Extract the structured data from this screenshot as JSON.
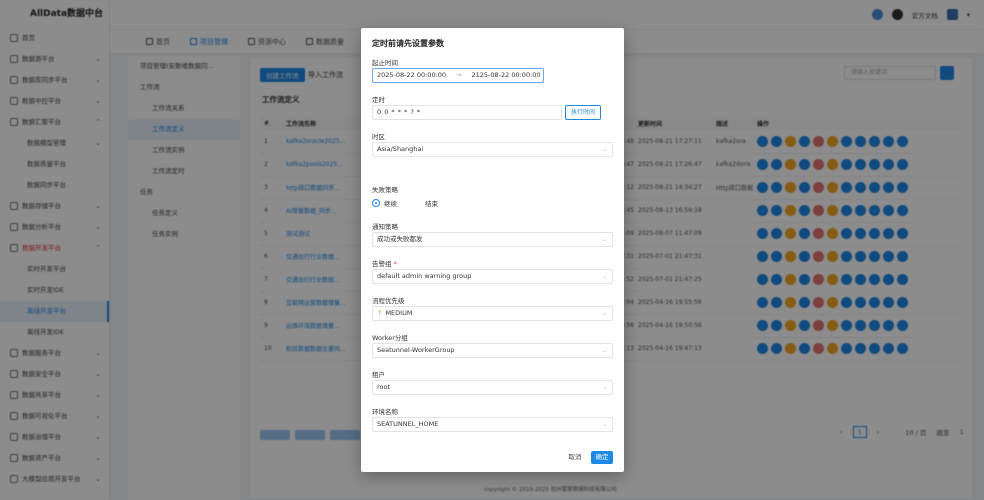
{
  "app": {
    "title": "AllData数据中台"
  },
  "header": {
    "docs_link": "官方文档"
  },
  "sidebar": {
    "items": [
      {
        "label": "首页",
        "type": "top"
      },
      {
        "label": "数据源平台",
        "type": "top",
        "caret": "⌄"
      },
      {
        "label": "数据库同步平台",
        "type": "top",
        "caret": "⌄"
      },
      {
        "label": "数据中控平台",
        "type": "top",
        "caret": "⌄"
      },
      {
        "label": "数据汇聚平台",
        "type": "top",
        "caret": "⌃"
      },
      {
        "label": "数据模型管理",
        "type": "sub",
        "caret": "⌄"
      },
      {
        "label": "数据质量平台",
        "type": "sub"
      },
      {
        "label": "数据同步平台",
        "type": "sub"
      },
      {
        "label": "数据存储平台",
        "type": "top",
        "caret": "⌄"
      },
      {
        "label": "数据分析平台",
        "type": "top",
        "caret": "⌄"
      },
      {
        "label": "数据开发平台",
        "type": "top-open",
        "caret": "⌃"
      },
      {
        "label": "实时开发平台",
        "type": "sub"
      },
      {
        "label": "实时开发IDE",
        "type": "sub"
      },
      {
        "label": "离线开发平台",
        "type": "sub-active"
      },
      {
        "label": "离线开发IDE",
        "type": "sub"
      },
      {
        "label": "数据服务平台",
        "type": "top",
        "caret": "⌄"
      },
      {
        "label": "数据安全平台",
        "type": "top",
        "caret": "⌄"
      },
      {
        "label": "数据共享平台",
        "type": "top",
        "caret": "⌄"
      },
      {
        "label": "数据可视化平台",
        "type": "top",
        "caret": "⌄"
      },
      {
        "label": "数据治理平台",
        "type": "top",
        "caret": "⌄"
      },
      {
        "label": "数据资产平台",
        "type": "top",
        "caret": "⌄"
      },
      {
        "label": "大模型应用开发平台",
        "type": "top",
        "caret": "⌄"
      }
    ]
  },
  "tabs": [
    {
      "label": "首页",
      "active": false
    },
    {
      "label": "项目管理",
      "active": true
    },
    {
      "label": "资源中心",
      "active": false
    },
    {
      "label": "数据质量",
      "active": false
    }
  ],
  "subnav": {
    "items": [
      {
        "label": "项目管理(安斯维数据同...",
        "level": 1
      },
      {
        "label": "工作流",
        "level": 1
      },
      {
        "label": "工作流关系",
        "level": 2
      },
      {
        "label": "工作流定义",
        "level": 2,
        "active": true
      },
      {
        "label": "工作流实例",
        "level": 2
      },
      {
        "label": "工作流定时",
        "level": 2
      },
      {
        "label": "任务",
        "level": 1
      },
      {
        "label": "任务定义",
        "level": 2
      },
      {
        "label": "任务实例",
        "level": 2
      }
    ]
  },
  "main": {
    "create_button": "创建工作流",
    "import_button": "导入工作流",
    "section_title": "工作流定义",
    "search_placeholder": "请输入关键词",
    "columns": [
      "#",
      "工作流名称",
      "更新时间",
      "描述",
      "操作"
    ],
    "rows": [
      {
        "no": "1",
        "name": "kafka2oracle2025...",
        "time_a": "2:04:48",
        "updated": "2025-08-21 17:27:11",
        "desc": "kafka2ora"
      },
      {
        "no": "2",
        "name": "kafka2pools2025...",
        "time_a": "7:26:47",
        "updated": "2025-08-21 17:26:47",
        "desc": "kafka2doris"
      },
      {
        "no": "3",
        "name": "http接口数据同步...",
        "time_a": "4:32:12",
        "updated": "2025-08-21 14:34:27",
        "desc": "Http接口数据"
      },
      {
        "no": "4",
        "name": "AI增量数据_同步...",
        "time_a": "5:05:45",
        "updated": "2025-08-13 16:59:18",
        "desc": ""
      },
      {
        "no": "5",
        "name": "测试测试",
        "time_a": "1:47:09",
        "updated": "2025-08-07 11:47:09",
        "desc": ""
      },
      {
        "no": "6",
        "name": "交通出行行业数据...",
        "time_a": "1:47:31",
        "updated": "2025-07-01 21:47:31",
        "desc": ""
      },
      {
        "no": "7",
        "name": "交通出行行业数据...",
        "time_a": "5:55:52",
        "updated": "2025-07-01 21:47:25",
        "desc": ""
      },
      {
        "no": "8",
        "name": "互联网运营数据增量...",
        "time_a": "5:52:04",
        "updated": "2025-04-16 19:55:56",
        "desc": ""
      },
      {
        "no": "9",
        "name": "运维环境数据增量...",
        "time_a": "5:50:56",
        "updated": "2025-04-16 19:50:56",
        "desc": ""
      },
      {
        "no": "10",
        "name": "航班数据数据全量同...",
        "time_a": "7:47:13",
        "updated": "2025-04-16 19:47:13",
        "desc": ""
      }
    ],
    "pagination": {
      "current": "1",
      "page_size": "10 / 页",
      "jump_label": "跳至",
      "jump_value": "1"
    }
  },
  "footer": {
    "copyright": "copyright © 2019-2025 杭州寰擎数据科技有限公司"
  },
  "modal": {
    "title": "定时前请先设置参数",
    "start_end_label": "起止时间",
    "start_time": "2025-08-22 00:00:00",
    "range_separator": "→",
    "end_time": "2125-08-22 00:00:00",
    "timing_label": "定时",
    "cron_value": "0 0 * * * ? *",
    "exec_time_button": "执行时间",
    "timezone_label": "时区",
    "timezone_value": "Asia/Shanghai",
    "failure_label": "失败策略",
    "failure_options": [
      {
        "label": "继续",
        "checked": true
      },
      {
        "label": "结束",
        "checked": false
      }
    ],
    "notify_label": "通知策略",
    "notify_value": "成功或失败都发",
    "alarm_label": "告警组",
    "alarm_required": "*",
    "alarm_value": "default admin warning group",
    "priority_label": "流程优先级",
    "priority_arrow": "↑",
    "priority_value": "MEDIUM",
    "worker_label": "Worker分组",
    "worker_value": "Seatunnel-WorkerGroup",
    "tenant_label": "租户",
    "tenant_value": "root",
    "env_label": "环境名称",
    "env_value": "SEATUNNEL_HOME",
    "cancel_button": "取消",
    "confirm_button": "确定"
  },
  "colors": {
    "accent": "#1e88e5",
    "priority_arrow": "#e8a33c",
    "required": "#e53935"
  },
  "icons": [
    "menu-icon",
    "github-icon",
    "avatar-icon",
    "search-icon",
    "dropdown-icon",
    "radio-icon"
  ]
}
